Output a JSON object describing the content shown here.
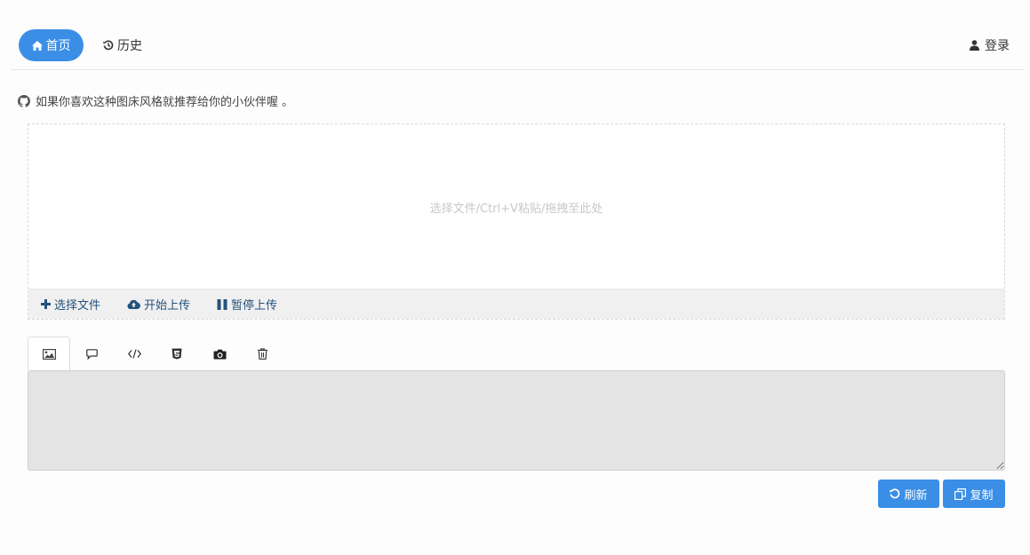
{
  "nav": {
    "home_label": "首页",
    "history_label": "历史",
    "login_label": "登录"
  },
  "promo": {
    "text": "如果你喜欢这种图床风格就推荐给你的小伙伴喔 。"
  },
  "uploader": {
    "drop_hint": "选择文件/Ctrl+V粘贴/拖拽至此处",
    "choose_label": "选择文件",
    "start_label": "开始上传",
    "pause_label": "暂停上传"
  },
  "tabs": [
    {
      "icon": "image-icon"
    },
    {
      "icon": "comment-icon"
    },
    {
      "icon": "code-icon"
    },
    {
      "icon": "html5-icon"
    },
    {
      "icon": "camera-icon"
    },
    {
      "icon": "trash-icon"
    }
  ],
  "output": {
    "value": ""
  },
  "actions": {
    "refresh_label": "刷新",
    "copy_label": "复制"
  },
  "colors": {
    "primary": "#3a8ee6",
    "link": "#23527c",
    "output_bg": "#e4e4e4"
  }
}
